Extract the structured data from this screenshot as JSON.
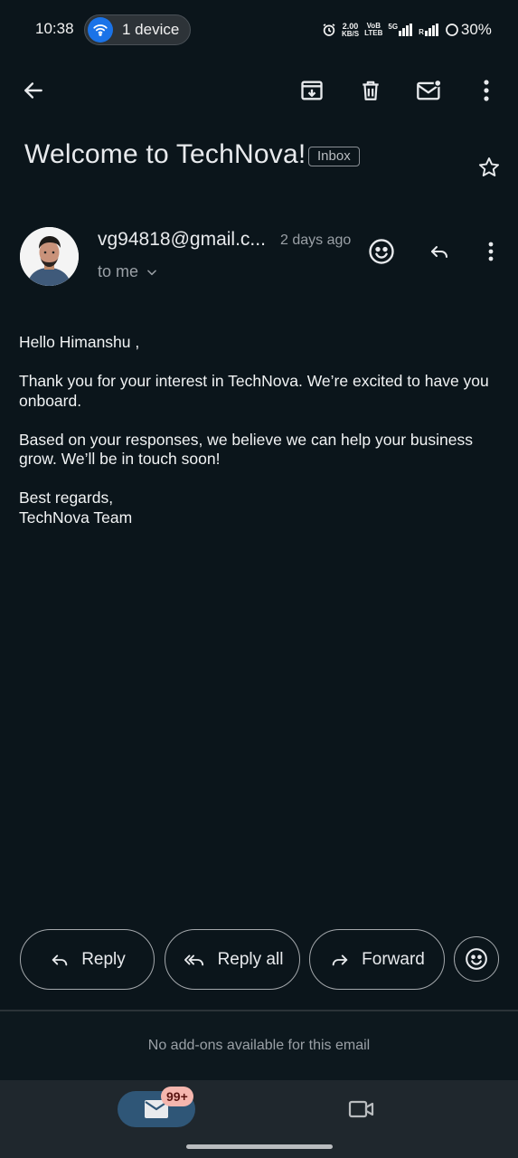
{
  "status_bar": {
    "time": "10:38",
    "device_pill": "1 device",
    "net_speed_value": "2.00",
    "net_speed_unit": "KB/S",
    "volte_top": "VoB",
    "volte_bottom": "LTEB",
    "network": "5G",
    "roaming": "R",
    "battery": "30%"
  },
  "toolbar": {
    "back": "arrow-left-icon",
    "archive": "archive-icon",
    "delete": "trash-icon",
    "mark_unread": "mail-unread-icon",
    "more": "more-vertical-icon"
  },
  "email": {
    "subject": "Welcome to TechNova!",
    "label": "Inbox",
    "sender": "vg94818@gmail.c...",
    "time_ago": "2 days ago",
    "recipient": "to me",
    "body": {
      "greeting": "Hello Himanshu ,",
      "paragraph1": "Thank you for your interest in TechNova. We’re excited to have you onboard.",
      "paragraph2": "Based on your responses, we believe we can help your business grow. We’ll be in touch soon!",
      "signoff": "Best regards,",
      "signature": "TechNova Team"
    }
  },
  "actions": {
    "reply": "Reply",
    "reply_all": "Reply all",
    "forward": "Forward"
  },
  "addons_text": "No add-ons available for this email",
  "bottom_nav": {
    "mail_badge": "99+"
  },
  "colors": {
    "background": "#0b151b",
    "accent_blue": "#1a73e8",
    "mail_pill": "#2f5677",
    "badge": "#f5b6ae"
  }
}
